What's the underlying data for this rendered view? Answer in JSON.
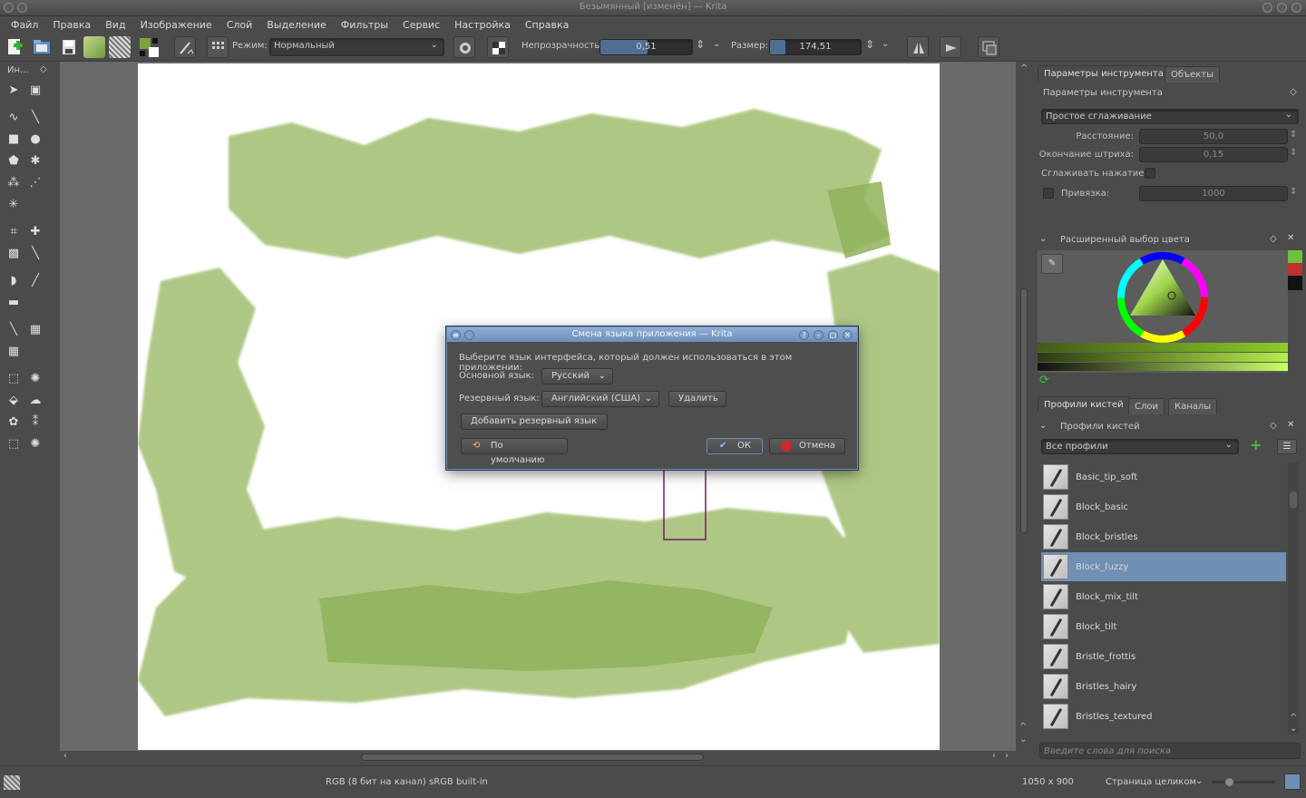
{
  "window": {
    "title": "Безымянный [изменён] — Krita"
  },
  "menu": [
    "Файл",
    "Правка",
    "Вид",
    "Изображение",
    "Слой",
    "Выделение",
    "Фильтры",
    "Сервис",
    "Настройка",
    "Справка"
  ],
  "toolbar": {
    "mode_label": "Режим:",
    "mode_value": "Нормальный",
    "opacity_label": "Непрозрачность:",
    "opacity_value": "0,51",
    "opacity_fraction": 0.51,
    "size_label": "Размер:",
    "size_value": "174,51",
    "size_fraction": 0.17
  },
  "toolbox": {
    "header": "Ин..."
  },
  "right": {
    "tabs_top": [
      "Параметры инструмента",
      "Объекты"
    ],
    "tool_options_title": "Параметры инструмента",
    "smoothing_value": "Простое сглаживание",
    "rows": [
      {
        "label": "Расстояние:",
        "value": "50,0"
      },
      {
        "label": "Окончание штриха:",
        "value": "0,15"
      },
      {
        "label": "Сглаживать нажатие",
        "value": ""
      },
      {
        "label": "Привязка:",
        "value": "1000"
      }
    ],
    "color_selector_title": "Расширенный выбор цвета",
    "tabs_mid": [
      "Профили кистей",
      "Слои",
      "Каналы"
    ],
    "brush_presets_title": "Профили кистей",
    "filter_value": "Все профили",
    "brushes": [
      "Basic_tip_soft",
      "Block_basic",
      "Block_bristles",
      "Block_fuzzy",
      "Block_mix_tilt",
      "Block_tilt",
      "Bristle_frottis",
      "Bristles_hairy",
      "Bristles_textured"
    ],
    "selected_brush": "Block_fuzzy",
    "search_placeholder": "Введите слова для поиска"
  },
  "status": {
    "color_info": "RGB (8 бит на канал)  sRGB built-in",
    "dimensions": "1050 x 900",
    "zoom_label": "Страница целиком"
  },
  "dialog": {
    "title": "Смена языка приложения — Krita",
    "prompt": "Выберите язык интерфейса, который должен использоваться в этом приложении:",
    "primary_label": "Основной язык:",
    "primary_value": "Русский",
    "fallback_label": "Резервный язык:",
    "fallback_value": "Английский (США)",
    "remove_button": "Удалить",
    "add_button": "Добавить резервный язык",
    "default_button": "По умолчанию",
    "ok_button": "ОК",
    "cancel_button": "Отмена"
  },
  "colors": {
    "accent": "#6f8fb4",
    "canvas_green": "#a9c37a",
    "bg": "#4b4b4b"
  }
}
